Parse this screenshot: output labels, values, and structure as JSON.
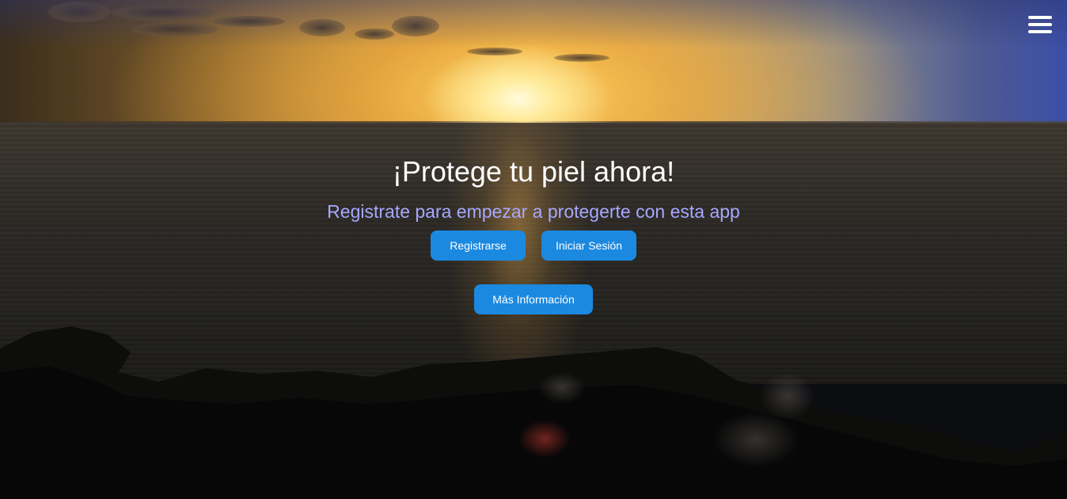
{
  "hero": {
    "title": "¡Protege tu piel ahora!",
    "subtitle": "Registrate para empezar a protegerte con esta app"
  },
  "buttons": {
    "register_label": "Registrarse",
    "login_label": "Iniciar Sesión",
    "info_label": "Más Información"
  },
  "icons": {
    "menu": "hamburger-menu-icon"
  },
  "colors": {
    "button_bg": "#1b89e0",
    "title": "#ffffff",
    "subtitle": "#a6a8ff"
  }
}
